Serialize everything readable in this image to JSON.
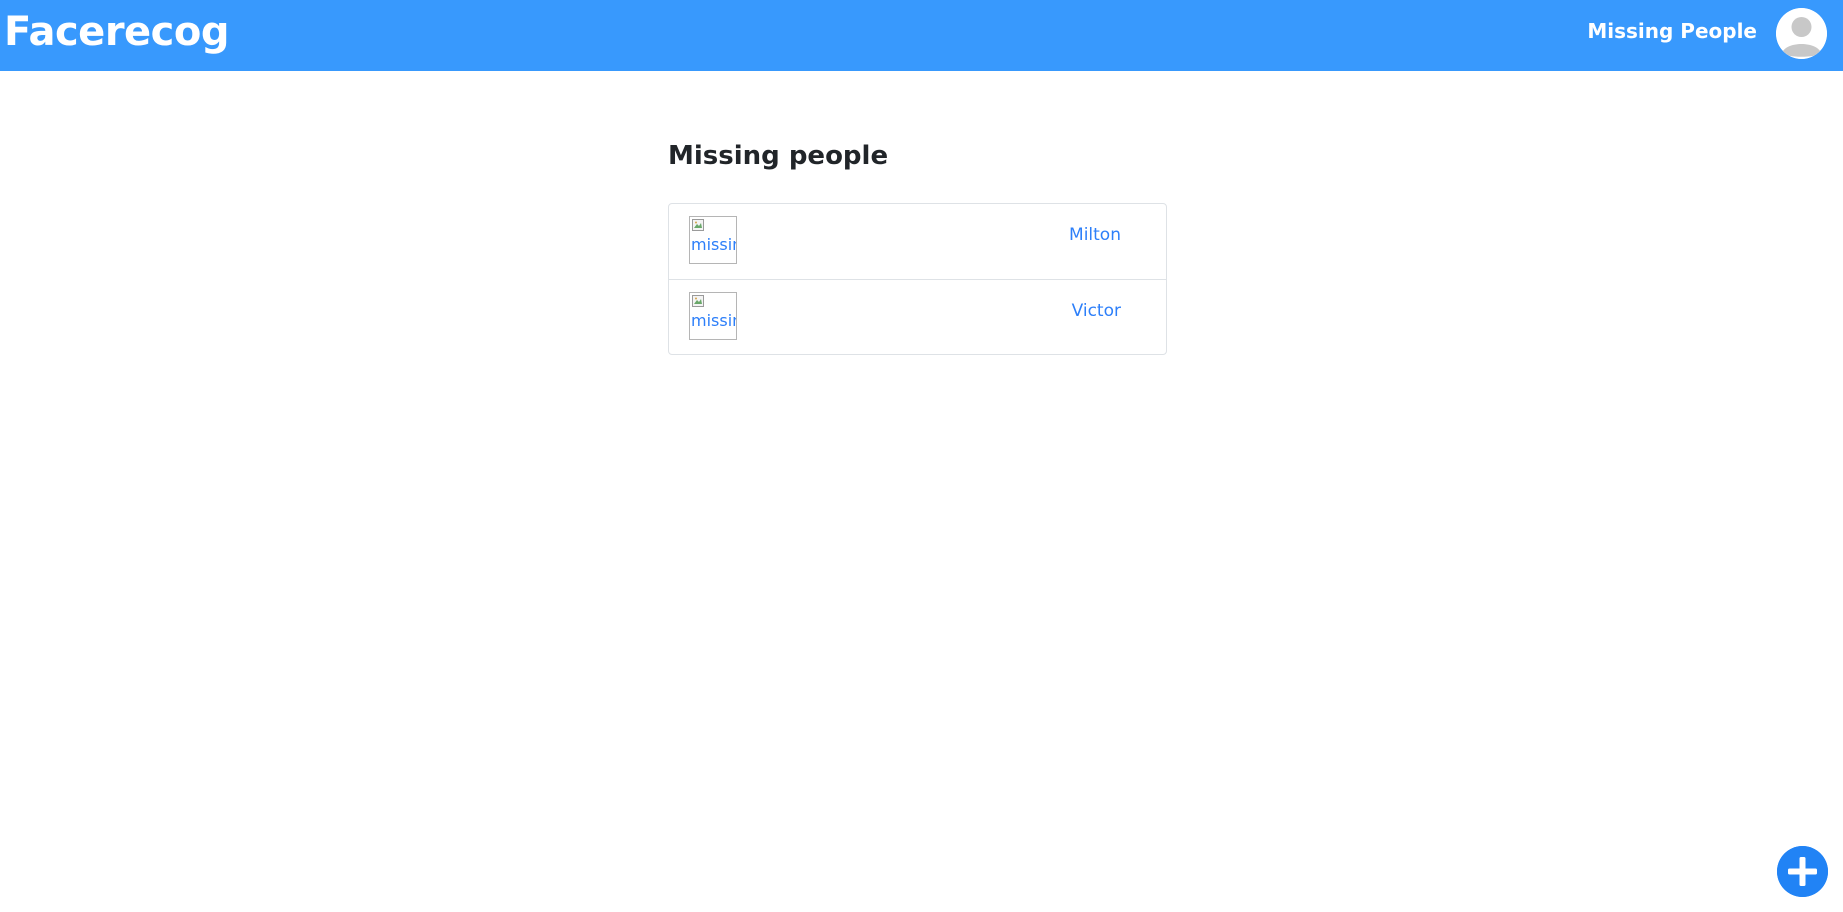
{
  "navbar": {
    "brand": "Facerecog",
    "nav_link": "Missing People",
    "avatar_icon": "user-avatar-icon"
  },
  "main": {
    "title": "Missing people",
    "people": [
      {
        "name": "Milton",
        "image_alt": "missing"
      },
      {
        "name": "Victor",
        "image_alt": "missing"
      }
    ]
  },
  "fab": {
    "icon": "plus-icon"
  },
  "colors": {
    "navbar_bg": "#3899fd",
    "link": "#2d7ff9",
    "fab_bg": "#2183f5"
  }
}
